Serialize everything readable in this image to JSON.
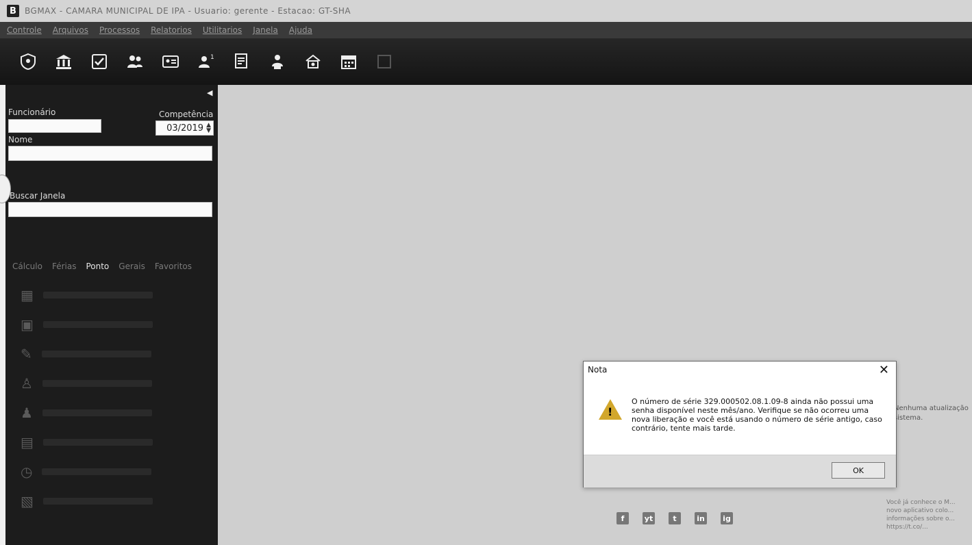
{
  "titlebar": {
    "icon_letter": "B",
    "title": "BGMAX - CAMARA MUNICIPAL DE IPA - Usuario: gerente - Estacao: GT-SHA"
  },
  "menu": [
    "Controle",
    "Arquivos",
    "Processos",
    "Relatorios",
    "Utilitarios",
    "Janela",
    "Ajuda"
  ],
  "toolbar": {
    "icons": [
      "shield-icon",
      "bank-icon",
      "checkbox-icon",
      "users-icon",
      "id-card-icon",
      "user-badge-icon",
      "document-icon",
      "group-icon",
      "house-money-icon",
      "calendar-icon",
      "disabled-icon"
    ]
  },
  "sidebar": {
    "funcionario_label": "Funcionário",
    "competencia_label": "Competência",
    "competencia_value": "03/2019",
    "nome_label": "Nome",
    "buscar_label": "Buscar Janela",
    "tabs": [
      {
        "label": "Cálculo",
        "active": false
      },
      {
        "label": "Férias",
        "active": false
      },
      {
        "label": "Ponto",
        "active": true
      },
      {
        "label": "Gerais",
        "active": false
      },
      {
        "label": "Favoritos",
        "active": false
      }
    ]
  },
  "dialog": {
    "title": "Nota",
    "message": "O número de série 329.000502.08.1.09-8 ainda não possui uma senha disponível neste mês/ano. Verifique se não ocorreu uma nova liberação e você está usando o número de série antigo, caso contrário, tente mais tarde.",
    "ok_label": "OK"
  },
  "side_notes": {
    "line1": "Nenhuma atualização",
    "line2": "sistema."
  },
  "news": {
    "text": "Você já conhece o M... novo aplicativo colo... informações sobre o... https://t.co/..."
  },
  "social": [
    "f",
    "yt",
    "t",
    "in",
    "ig"
  ],
  "colors": {
    "toolbar_bg": "#1a1a1a",
    "sidebar_bg": "#1c1c1c",
    "main_bg": "#cfcfcf",
    "warning": "#d2a72c"
  }
}
